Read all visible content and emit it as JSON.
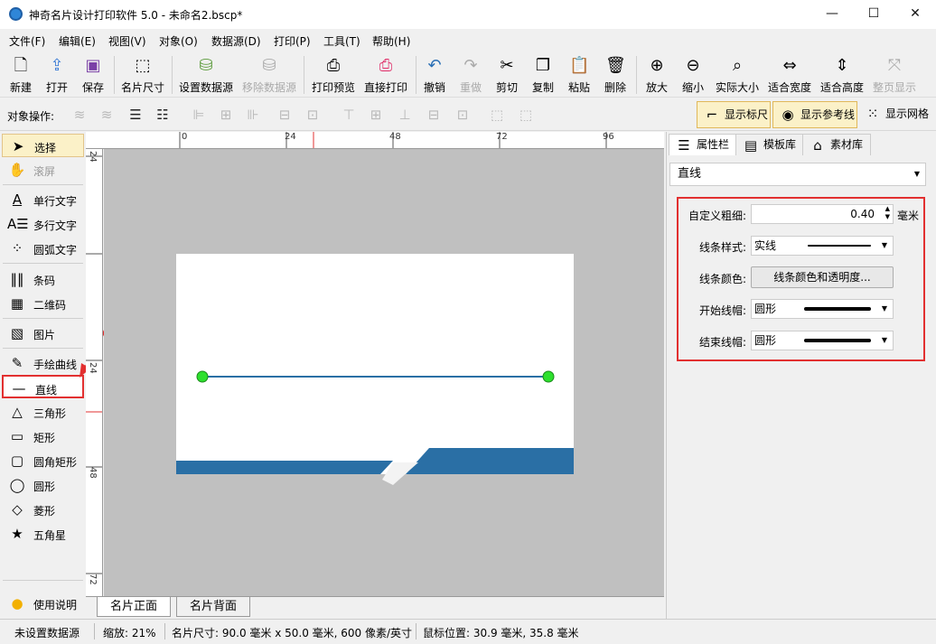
{
  "window": {
    "title": "神奇名片设计打印软件 5.0 - 未命名2.bscp*",
    "minimize": "—",
    "maximize": "☐",
    "close": "✕"
  },
  "menu": [
    "文件(F)",
    "编辑(E)",
    "视图(V)",
    "对象(O)",
    "数据源(D)",
    "打印(P)",
    "工具(T)",
    "帮助(H)"
  ],
  "toolbar": {
    "new": "新建",
    "open": "打开",
    "save": "保存",
    "card_size": "名片尺寸",
    "set_datasource": "设置数据源",
    "remove_datasource": "移除数据源",
    "print_preview": "打印预览",
    "direct_print": "直接打印",
    "undo": "撤销",
    "redo": "重做",
    "cut": "剪切",
    "copy": "复制",
    "paste": "粘贴",
    "delete": "删除",
    "zoom_in": "放大",
    "zoom_out": "缩小",
    "actual_size": "实际大小",
    "fit_width": "适合宽度",
    "fit_height": "适合高度",
    "fit_page": "整页显示"
  },
  "object_bar": {
    "label": "对象操作:",
    "show_ruler": "显示标尺",
    "show_guides": "显示参考线",
    "show_grid": "显示网格"
  },
  "tools": {
    "select": "选择",
    "scroll": "滚屏",
    "single_text": "单行文字",
    "multi_text": "多行文字",
    "arc_text": "圆弧文字",
    "barcode": "条码",
    "qrcode": "二维码",
    "image": "图片",
    "freehand": "手绘曲线",
    "line": "直线",
    "triangle": "三角形",
    "rect": "矩形",
    "round_rect": "圆角矩形",
    "ellipse": "圆形",
    "diamond": "菱形",
    "star": "五角星",
    "help": "使用说明"
  },
  "ruler": {
    "top": [
      "0",
      "24",
      "48",
      "72",
      "96"
    ],
    "left": [
      "24",
      "24",
      "48",
      "72"
    ]
  },
  "card_tabs": {
    "front": "名片正面",
    "back": "名片背面"
  },
  "right_panel": {
    "tabs": {
      "properties": "属性栏",
      "templates": "模板库",
      "materials": "素材库"
    },
    "object_type": "直线",
    "props": {
      "thickness_label": "自定义粗细:",
      "thickness_value": "0.40",
      "thickness_unit": "毫米",
      "style_label": "线条样式:",
      "style_value": "实线",
      "color_label": "线条颜色:",
      "color_button": "线条颜色和透明度...",
      "start_cap_label": "开始线帽:",
      "start_cap_value": "圆形",
      "end_cap_label": "结束线帽:",
      "end_cap_value": "圆形"
    }
  },
  "status": {
    "datasource": "未设置数据源",
    "zoom": "缩放: 21%",
    "card_size": "名片尺寸: 90.0 毫米 x 50.0 毫米, 600 像素/英寸",
    "mouse_pos": "鼠标位置: 30.9 毫米, 35.8 毫米"
  },
  "colors": {
    "accent_blue": "#2a6fa5",
    "handle_green": "#2ee02e",
    "highlight_red": "#e23030",
    "canvas_gray": "#c0c0c0"
  }
}
